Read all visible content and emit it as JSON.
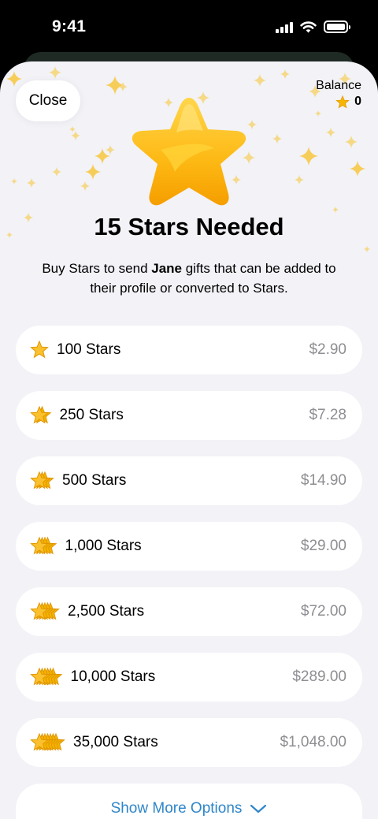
{
  "status_bar": {
    "time": "9:41"
  },
  "header": {
    "close_label": "Close",
    "balance_label": "Balance",
    "balance_value": "0"
  },
  "title": "15 Stars Needed",
  "subtitle": {
    "before": "Buy Stars to send ",
    "name": "Jane",
    "after": " gifts that can be added to their profile or converted to Stars."
  },
  "options": [
    {
      "label": "100 Stars",
      "price": "$2.90",
      "star_count": 1
    },
    {
      "label": "250 Stars",
      "price": "$7.28",
      "star_count": 2
    },
    {
      "label": "500 Stars",
      "price": "$14.90",
      "star_count": 3
    },
    {
      "label": "1,000 Stars",
      "price": "$29.00",
      "star_count": 4
    },
    {
      "label": "2,500 Stars",
      "price": "$72.00",
      "star_count": 5
    },
    {
      "label": "10,000 Stars",
      "price": "$289.00",
      "star_count": 6
    },
    {
      "label": "35,000 Stars",
      "price": "$1,048.00",
      "star_count": 7
    }
  ],
  "more_options_label": "Show More Options",
  "colors": {
    "accent": "#2f86c9",
    "star_gold": "#f7b500",
    "sheet_background": "#f2f2f7",
    "price_gray": "#8e8e93"
  },
  "icons": {
    "hero": "star-icon",
    "balance": "star-icon",
    "option": "stacked-stars-icon",
    "more": "chevron-down-icon"
  }
}
